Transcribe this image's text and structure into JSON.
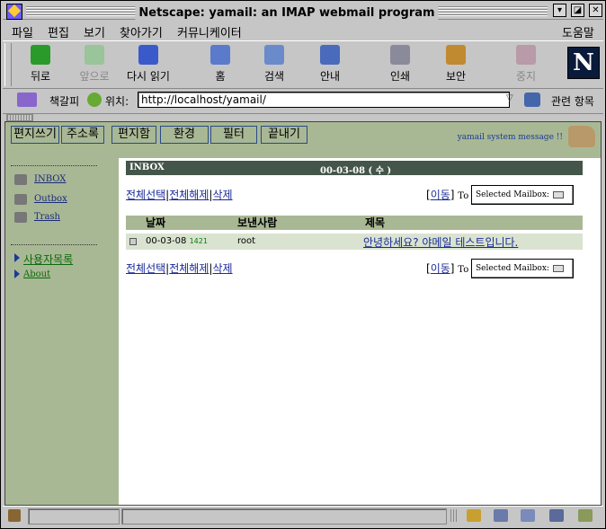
{
  "window": {
    "title": "Netscape: yamail: an IMAP webmail program"
  },
  "menu": [
    {
      "label": "파일"
    },
    {
      "label": "편집"
    },
    {
      "label": "보기"
    },
    {
      "label": "찾아가기"
    },
    {
      "label": "커뮤니케이터"
    },
    {
      "label": "도움말"
    }
  ],
  "toolbar": [
    {
      "label": "뒤로"
    },
    {
      "label": "앞으로"
    },
    {
      "label": "다시 읽기"
    },
    {
      "label": "홈"
    },
    {
      "label": "검색"
    },
    {
      "label": "안내"
    },
    {
      "label": "인쇄"
    },
    {
      "label": "보안"
    },
    {
      "label": "중지"
    }
  ],
  "location": {
    "bookmarks_label": "책갈피",
    "location_label": "위치:",
    "url": "http://localhost/yamail/",
    "related_label": "관련 항목"
  },
  "nav": [
    {
      "label": "편지쓰기"
    },
    {
      "label": "주소록"
    },
    {
      "label": "편지함"
    },
    {
      "label": "환경"
    },
    {
      "label": "필터"
    },
    {
      "label": "끝내기"
    }
  ],
  "system_message": "yamail system message !!",
  "sidebar": {
    "folders": [
      {
        "label": "INBOX"
      },
      {
        "label": "Outbox"
      },
      {
        "label": "Trash"
      }
    ],
    "links": [
      {
        "label": "사용자목록"
      },
      {
        "label": "About"
      }
    ]
  },
  "mailbox": {
    "name": "INBOX",
    "date": "00-03-08 ( 수 )",
    "actions": {
      "select_all": "전체선택",
      "deselect_all": "전체해제",
      "delete": "삭제",
      "move": "이동",
      "to": "To",
      "mailbox_select": "Selected Mailbox:"
    },
    "columns": [
      "날짜",
      "보낸사람",
      "제목"
    ],
    "messages": [
      {
        "date": "00-03-08",
        "size": "1421",
        "from": "root",
        "subject": "안녕하세요? 야메일 테스트입니다."
      }
    ]
  },
  "colors": {
    "accent": "#a9b894",
    "inbox_bar": "#44554a",
    "link": "#1a2a9a"
  }
}
